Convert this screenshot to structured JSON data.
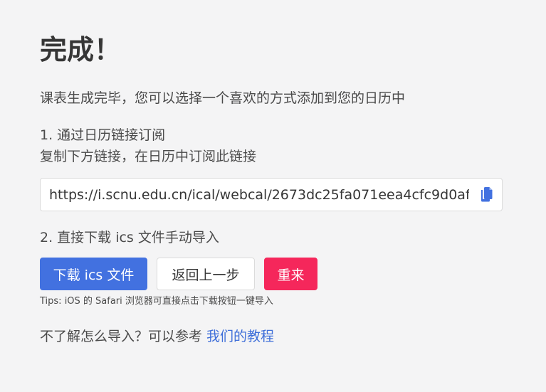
{
  "title": "完成！",
  "intro": "课表生成完毕，您可以选择一个喜欢的方式添加到您的日历中",
  "step1": {
    "title": "1. 通过日历链接订阅",
    "description": "复制下方链接，在日历中订阅此链接",
    "url": "https://i.scnu.edu.cn/ical/webcal/2673dc25fa071eea4cfc9d0af",
    "copy_icon": "copy-icon"
  },
  "step2": {
    "title": "2. 直接下载 ics 文件手动导入"
  },
  "buttons": {
    "download": "下载 ics 文件",
    "back": "返回上一步",
    "restart": "重来"
  },
  "tips": "Tips: iOS 的 Safari 浏览器可直接点击下载按钮一键导入",
  "help": {
    "text": "不了解怎么导入？可以参考 ",
    "link": "我们的教程"
  },
  "colors": {
    "primary": "#4271e0",
    "danger": "#f5275b",
    "link": "#3f6fd9",
    "background": "#f4f4f5"
  }
}
